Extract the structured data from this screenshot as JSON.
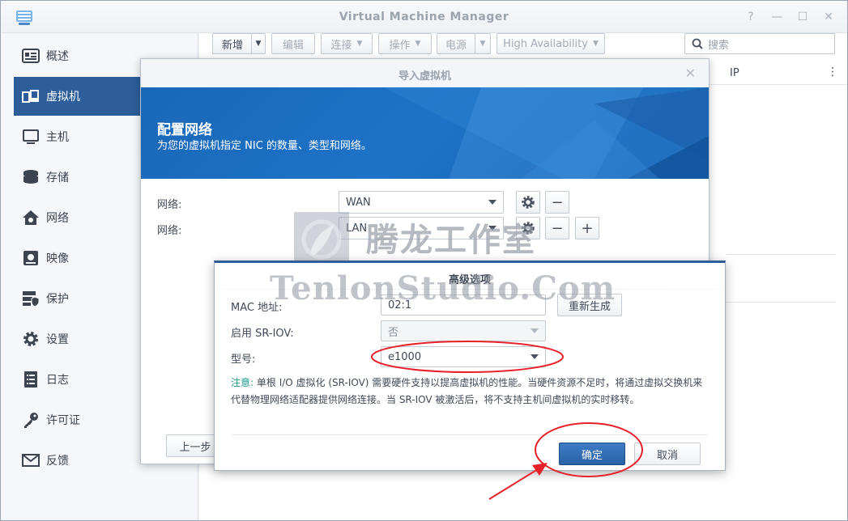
{
  "app": {
    "title": "Virtual Machine Manager"
  },
  "window_controls": {
    "help": "?",
    "minimize": "—",
    "maximize": "☐",
    "close": "✕"
  },
  "sidebar": {
    "items": [
      {
        "label": "概述",
        "icon": "overview-icon"
      },
      {
        "label": "虚拟机",
        "icon": "virtual-machine-icon",
        "active": true
      },
      {
        "label": "主机",
        "icon": "host-icon"
      },
      {
        "label": "存储",
        "icon": "storage-icon"
      },
      {
        "label": "网络",
        "icon": "network-icon"
      },
      {
        "label": "映像",
        "icon": "image-icon"
      },
      {
        "label": "保护",
        "icon": "protection-icon"
      },
      {
        "label": "设置",
        "icon": "settings-icon"
      },
      {
        "label": "日志",
        "icon": "log-icon"
      },
      {
        "label": "许可证",
        "icon": "license-icon"
      },
      {
        "label": "反馈",
        "icon": "feedback-icon"
      }
    ]
  },
  "toolbar": {
    "new_label": "新增",
    "edit_label": "编辑",
    "connect_label": "连接",
    "action_label": "操作",
    "power_label": "电源",
    "ha_label": "High Availability",
    "search_placeholder": "搜索"
  },
  "table": {
    "col_ip": "IP",
    "col_more": "⋮"
  },
  "wizard": {
    "title": "导入虚拟机",
    "heading": "配置网络",
    "subtitle": "为您的虚拟机指定 NIC 的数量、类型和网络。",
    "network_label": "网络:",
    "networks": [
      "WAN",
      "LAN"
    ],
    "prev_label": "上一步"
  },
  "advanced": {
    "title": "高级选项",
    "mac_label": "MAC 地址:",
    "mac_value": "02:1",
    "regen_label": "重新生成",
    "sriov_label": "启用 SR-IOV:",
    "sriov_value": "否",
    "model_label": "型号:",
    "model_value": "e1000",
    "note_prefix": "注意:",
    "note_text": "单根 I/O 虚拟化 (SR-IOV) 需要硬件支持以提高虚拟机的性能。当硬件资源不足时，将通过虚拟交换机来代替物理网络适配器提供网络连接。当 SR-IOV 被激活后，将不支持主机间虚拟机的实时移转。",
    "ok_label": "确定",
    "cancel_label": "取消"
  },
  "watermark": {
    "cn": "腾龙工作室",
    "en": "TenlonStudio.Com"
  },
  "colors": {
    "accent": "#2d5e9a",
    "banner": "#1e6ec3",
    "annotation": "#e8202a"
  }
}
